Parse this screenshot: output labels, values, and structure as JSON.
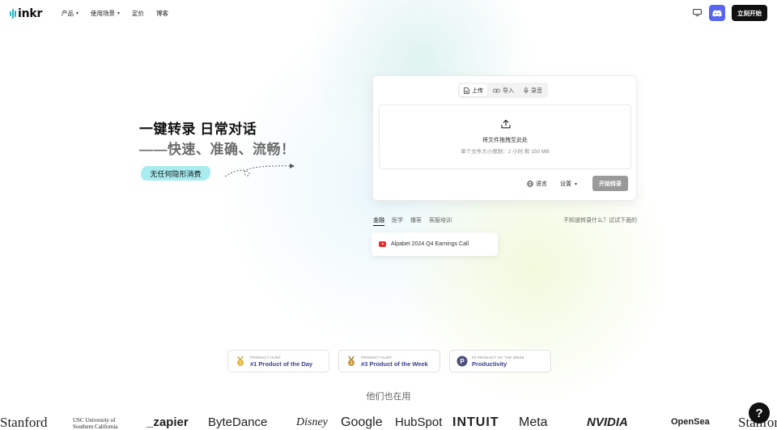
{
  "header": {
    "logo_text": "inkr",
    "nav": [
      {
        "label": "产品",
        "has_dropdown": true
      },
      {
        "label": "使用场景",
        "has_dropdown": true
      },
      {
        "label": "定价",
        "has_dropdown": false
      },
      {
        "label": "博客",
        "has_dropdown": false
      }
    ],
    "cta_label": "立刻开始",
    "icons": [
      "monitor-icon",
      "discord-icon"
    ]
  },
  "hero": {
    "line1": "一键转录 日常对话",
    "line2": "——快速、准确、流畅！",
    "badge": "无任何隐形消费"
  },
  "upload_card": {
    "tabs": [
      {
        "label": "上传",
        "icon": "file-icon",
        "active": true
      },
      {
        "label": "导入",
        "icon": "link-icon",
        "active": false
      },
      {
        "label": "录音",
        "icon": "mic-icon",
        "active": false
      }
    ],
    "dropzone_title": "将文件拖拽至此处",
    "dropzone_subtitle": "单个文件大小限制：2 小时 和 150 MB",
    "language_label": "语言",
    "settings_label": "设置",
    "start_label": "开始转录"
  },
  "samples": {
    "categories": [
      {
        "label": "金融",
        "active": true
      },
      {
        "label": "医学",
        "active": false
      },
      {
        "label": "播客",
        "active": false
      },
      {
        "label": "客服培训",
        "active": false
      }
    ],
    "hint": "不知道转录什么？试试下面的",
    "items": [
      {
        "title": "Alpabet 2024 Q4 Earnings Call",
        "icon": "youtube-icon"
      }
    ]
  },
  "awards": [
    {
      "small": "PRODUCT HUNT",
      "main": "#1 Product of the Day",
      "icon": "medal-icon"
    },
    {
      "small": "PRODUCT HUNT",
      "main": "#3 Product of the Week",
      "icon": "medal-icon"
    },
    {
      "small": "#2 PRODUCT OF THE WEEK",
      "main": "Productivity",
      "icon": "producthunt-p-icon"
    }
  ],
  "clients": {
    "title": "他们也在用",
    "logos": [
      "Stanford",
      "USC University of Southern California",
      "_zapier",
      "ByteDance",
      "Disney",
      "Google",
      "HubSpot",
      "INTUIT",
      "Meta",
      "NVIDIA",
      "OpenSea",
      "Stanford"
    ]
  },
  "colors": {
    "accent_teal": "#20b2c8",
    "discord": "#5865f2",
    "badge_bg": "#a9ecef",
    "award_text": "#3a3f8f"
  }
}
